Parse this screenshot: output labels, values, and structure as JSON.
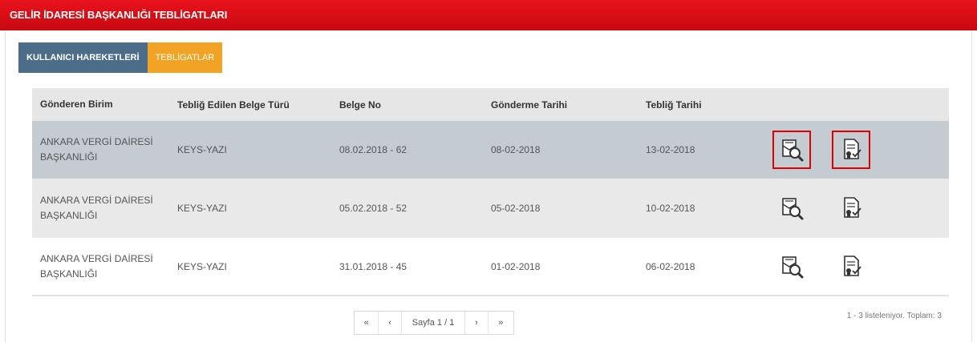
{
  "header": {
    "title": "GELİR İDARESİ BAŞKANLIĞI TEBLİGATLARI"
  },
  "tabs": [
    {
      "label": "KULLANICI HAREKETLERİ"
    },
    {
      "label": "TEBLİGATLAR"
    }
  ],
  "table": {
    "columns": [
      "Gönderen Birim",
      "Tebliğ Edilen Belge Türü",
      "Belge No",
      "Gönderme Tarihi",
      "Tebliğ Tarihi"
    ],
    "rows": [
      {
        "birim_line1": "ANKARA VERGİ DAİRESİ",
        "birim_line2": "BAŞKANLIĞI",
        "belge_turu": "KEYS-YAZI",
        "belge_no": "08.02.2018 - 62",
        "gonderme": "08-02-2018",
        "teblig": "13-02-2018"
      },
      {
        "birim_line1": "ANKARA VERGİ DAİRESİ",
        "birim_line2": "BAŞKANLIĞI",
        "belge_turu": "KEYS-YAZI",
        "belge_no": "05.02.2018 - 52",
        "gonderme": "05-02-2018",
        "teblig": "10-02-2018"
      },
      {
        "birim_line1": "ANKARA VERGİ DAİRESİ",
        "birim_line2": "BAŞKANLIĞI",
        "belge_turu": "KEYS-YAZI",
        "belge_no": "31.01.2018 - 45",
        "gonderme": "01-02-2018",
        "teblig": "06-02-2018"
      }
    ],
    "row_icons": [
      "document-search-icon",
      "certificate-document-icon"
    ]
  },
  "pager": {
    "first": "«",
    "prev": "‹",
    "page_label": "Sayfa",
    "page_value": "1 / 1",
    "next": "›",
    "last": "»",
    "info": "1 - 3 listeleniyor. Toplam: 3"
  },
  "colors": {
    "header_red": "#d90b14",
    "tab_active": "#4c6d8a",
    "tab_alt": "#f3a323",
    "row_selected": "#c4cbd1",
    "highlight_border": "#e00000"
  }
}
